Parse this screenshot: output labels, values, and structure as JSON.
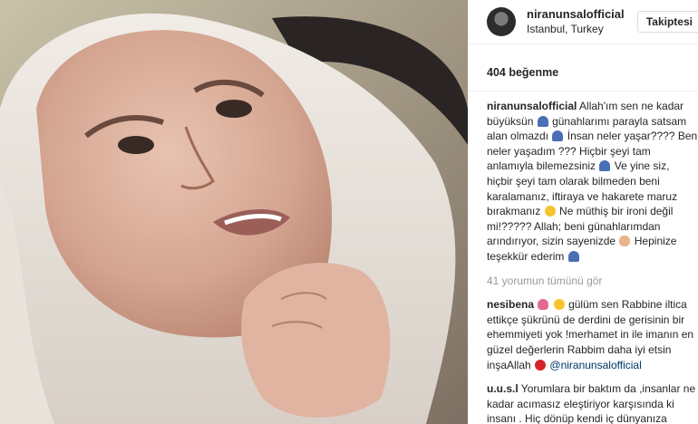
{
  "post": {
    "photo_alt": "selfie photo"
  },
  "header": {
    "username": "niranunsalofficial",
    "location": "Istanbul, Turkey",
    "follow_label": "Takiptesi"
  },
  "likes_text": "404 beğenme",
  "caption": {
    "user": "niranunsalofficial",
    "parts": [
      "Allah'ım sen ne kadar büyüksün",
      "günahlarımı parayla satsam alan olmazdı",
      "İnsan neler yaşar???? Ben neler yaşadım ??? Hiçbir şeyi tam anlamıyla bilemezsiniz",
      "Ve yine siz, hiçbir şeyi tam olarak bilmeden beni karalamanız, iftiraya ve hakarete maruz bırakmanız",
      "Ne müthiş bir ironi değil mi!????? Allah; beni günahlarımdan arındırıyor, sizin sayenizde",
      "Hepinize teşekkür ederim"
    ]
  },
  "view_all_comments": "41 yorumun tümünü gör",
  "comments": [
    {
      "user": "nesibena",
      "text_1": "gülüm sen Rabbine iltica ettikçe şükrünü de derdini de gerisinin bir ehemmiyeti yok !merhamet in ile imanın en güzel değerlerin Rabbim daha iyi etsin inşaAllah",
      "mention": "@niranunsalofficial"
    },
    {
      "user": "u.u.s.l",
      "text_1": "Yorumlara bir baktım da ,insanlar ne kadar acımasız eleştiriyor karşısında ki insanı . Hiç dönüp kendi iç dünyanıza"
    }
  ],
  "icons": {
    "pray": "person-praying-icon",
    "face": "smiley-face-icon",
    "clap": "clapping-hands-icon",
    "flower": "tulip-icon",
    "lips": "kiss-lips-icon"
  }
}
